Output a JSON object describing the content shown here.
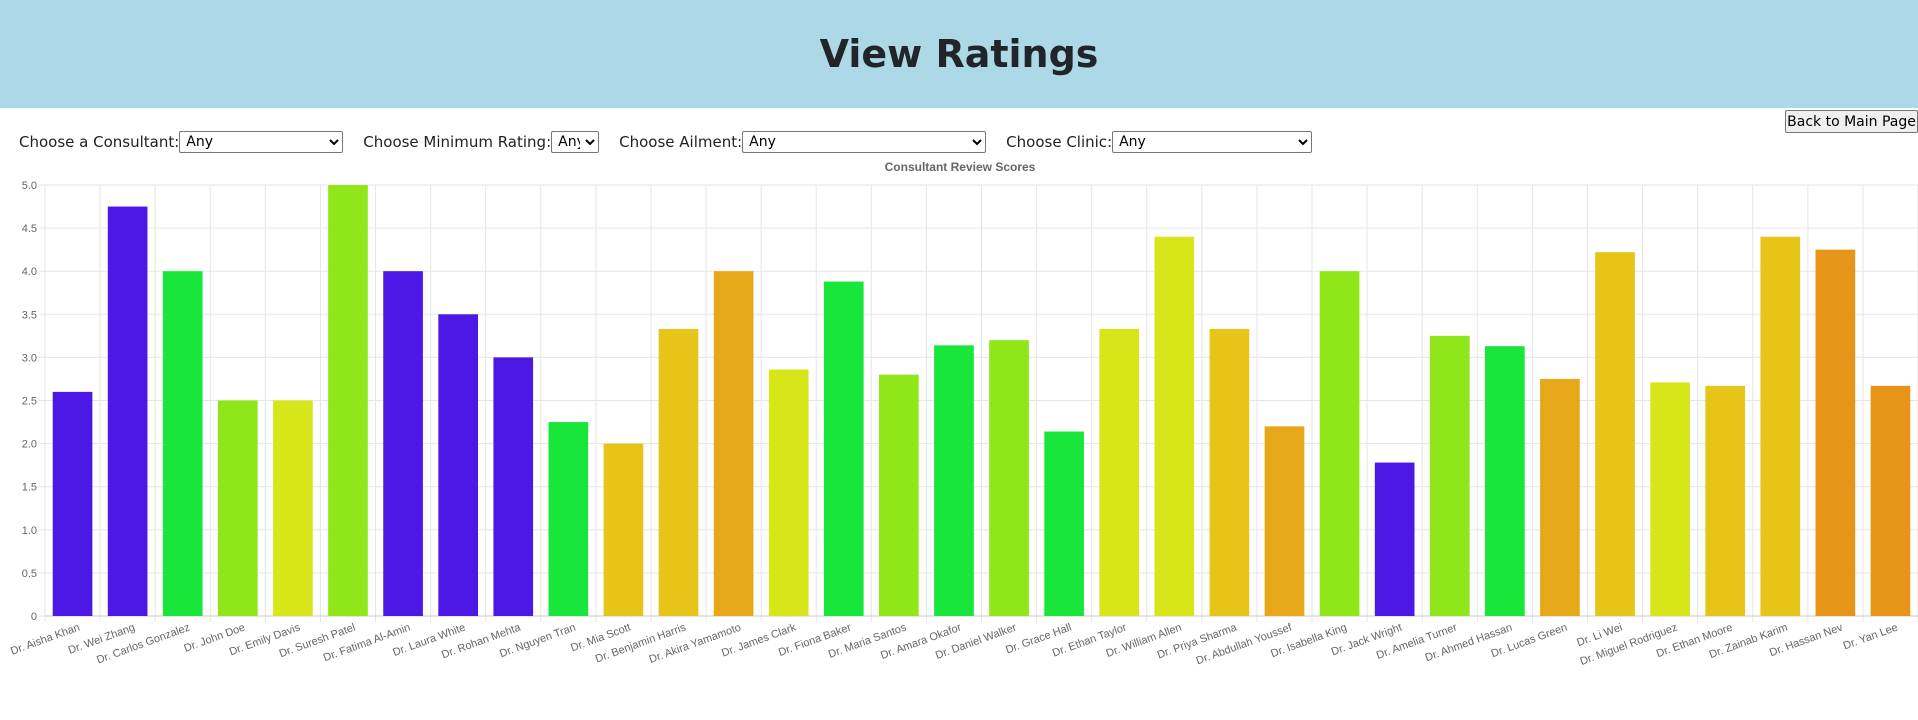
{
  "page": {
    "title": "View Ratings",
    "back_button": "Back to Main Page"
  },
  "filters": {
    "consultant": {
      "label": "Choose a Consultant:",
      "value": "Any"
    },
    "min_rating": {
      "label": "Choose Minimum Rating:",
      "value": "Any"
    },
    "ailment": {
      "label": "Choose Ailment:",
      "value": "Any"
    },
    "clinic": {
      "label": "Choose Clinic:",
      "value": "Any"
    }
  },
  "chart_data": {
    "type": "bar",
    "title": "Consultant Review Scores",
    "xlabel": "",
    "ylabel": "",
    "ylim": [
      0,
      5
    ],
    "yticks": [
      "0",
      "0.5",
      "1.0",
      "1.5",
      "2.0",
      "2.5",
      "3.0",
      "3.5",
      "4.0",
      "4.5",
      "5.0"
    ],
    "grid": true,
    "categories": [
      "Dr. Aisha Khan",
      "Dr. Wei Zhang",
      "Dr. Carlos Gonzalez",
      "Dr. John Doe",
      "Dr. Emily Davis",
      "Dr. Suresh Patel",
      "Dr. Fatima Al-Amin",
      "Dr. Laura White",
      "Dr. Rohan Mehta",
      "Dr. Nguyen Tran",
      "Dr. Mia Scott",
      "Dr. Benjamin Harris",
      "Dr. Akira Yamamoto",
      "Dr. James Clark",
      "Dr. Fiona Baker",
      "Dr. Maria Santos",
      "Dr. Amara Okafor",
      "Dr. Daniel Walker",
      "Dr. Grace Hall",
      "Dr. Ethan Taylor",
      "Dr. William Allen",
      "Dr. Priya Sharma",
      "Dr. Abdullah Youssef",
      "Dr. Isabella King",
      "Dr. Jack Wright",
      "Dr. Amelia Turner",
      "Dr. Ahmed Hassan",
      "Dr. Lucas Green",
      "Dr. Li Wei",
      "Dr. Miguel Rodriguez",
      "Dr. Ethan Moore",
      "Dr. Zainab Karim",
      "Dr. Hassan Nev",
      "Dr. Yan Lee"
    ],
    "values": [
      2.6,
      4.75,
      4.0,
      2.5,
      2.5,
      5.0,
      4.0,
      3.5,
      3.0,
      2.25,
      2.0,
      3.33,
      4.0,
      2.86,
      3.88,
      2.8,
      3.14,
      3.2,
      2.14,
      3.33,
      4.4,
      3.33,
      2.2,
      4.0,
      1.78,
      3.25,
      3.13,
      2.75,
      4.22,
      2.71,
      2.67,
      4.4,
      4.25,
      2.67
    ],
    "colors": [
      "#4b18e6",
      "#4b18e6",
      "#18e63a",
      "#8fe618",
      "#d6e618",
      "#8fe618",
      "#4b18e6",
      "#4b18e6",
      "#4b18e6",
      "#18e63a",
      "#e6c418",
      "#e6c418",
      "#e6a818",
      "#d6e618",
      "#18e63a",
      "#8fe618",
      "#18e63a",
      "#8fe618",
      "#18e63a",
      "#d6e618",
      "#d6e618",
      "#e6c418",
      "#e6a818",
      "#8fe618",
      "#4b18e6",
      "#8fe618",
      "#18e63a",
      "#e6a818",
      "#e6c418",
      "#d6e618",
      "#e6c418",
      "#e6c418",
      "#e69518",
      "#e69518"
    ]
  }
}
